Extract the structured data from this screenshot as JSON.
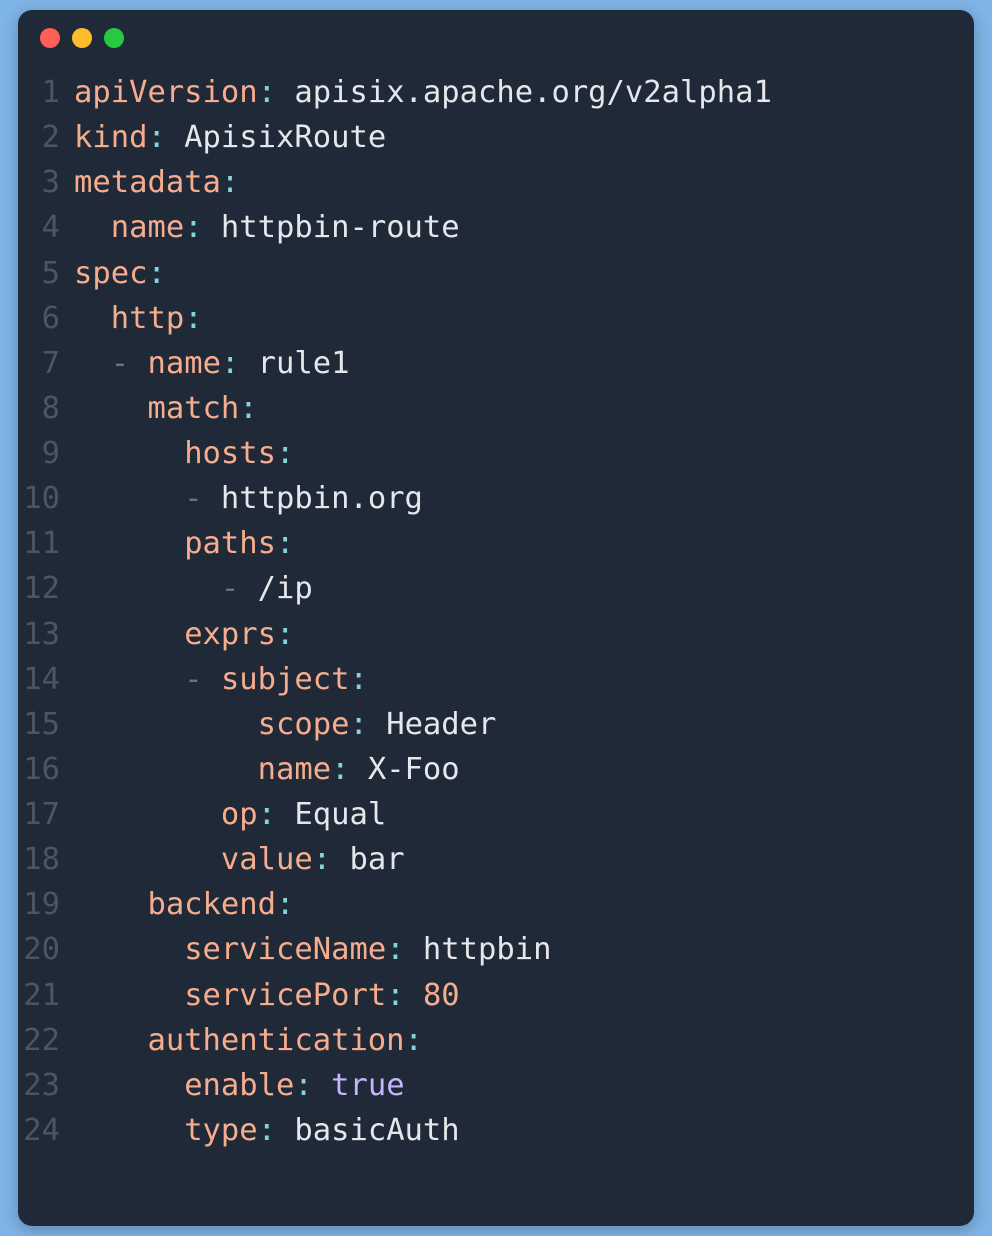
{
  "window": {
    "traffic_lights": [
      "red",
      "yellow",
      "green"
    ]
  },
  "colors": {
    "background": "#1f2937",
    "key": "#f6ad8e",
    "punct": "#83d6d8",
    "string": "#e5e7eb",
    "dash": "#6b7280",
    "bool": "#c4b5fd",
    "linenum": "#4b5563"
  },
  "code": {
    "lines": [
      {
        "n": "1",
        "tokens": [
          {
            "c": "k",
            "t": "apiVersion"
          },
          {
            "c": "p",
            "t": ":"
          },
          {
            "c": "s",
            "t": " apisix.apache.org/v2alpha1"
          }
        ]
      },
      {
        "n": "2",
        "tokens": [
          {
            "c": "k",
            "t": "kind"
          },
          {
            "c": "p",
            "t": ":"
          },
          {
            "c": "s",
            "t": " ApisixRoute"
          }
        ]
      },
      {
        "n": "3",
        "tokens": [
          {
            "c": "k",
            "t": "metadata"
          },
          {
            "c": "p",
            "t": ":"
          }
        ]
      },
      {
        "n": "4",
        "tokens": [
          {
            "c": "s",
            "t": "  "
          },
          {
            "c": "k",
            "t": "name"
          },
          {
            "c": "p",
            "t": ":"
          },
          {
            "c": "s",
            "t": " httpbin-route"
          }
        ]
      },
      {
        "n": "5",
        "tokens": [
          {
            "c": "k",
            "t": "spec"
          },
          {
            "c": "p",
            "t": ":"
          }
        ]
      },
      {
        "n": "6",
        "tokens": [
          {
            "c": "s",
            "t": "  "
          },
          {
            "c": "k",
            "t": "http"
          },
          {
            "c": "p",
            "t": ":"
          }
        ]
      },
      {
        "n": "7",
        "tokens": [
          {
            "c": "s",
            "t": "  "
          },
          {
            "c": "d",
            "t": "-"
          },
          {
            "c": "s",
            "t": " "
          },
          {
            "c": "k",
            "t": "name"
          },
          {
            "c": "p",
            "t": ":"
          },
          {
            "c": "s",
            "t": " rule1"
          }
        ]
      },
      {
        "n": "8",
        "tokens": [
          {
            "c": "s",
            "t": "    "
          },
          {
            "c": "k",
            "t": "match"
          },
          {
            "c": "p",
            "t": ":"
          }
        ]
      },
      {
        "n": "9",
        "tokens": [
          {
            "c": "s",
            "t": "      "
          },
          {
            "c": "k",
            "t": "hosts"
          },
          {
            "c": "p",
            "t": ":"
          }
        ]
      },
      {
        "n": "10",
        "tokens": [
          {
            "c": "s",
            "t": "      "
          },
          {
            "c": "d",
            "t": "-"
          },
          {
            "c": "s",
            "t": " httpbin.org"
          }
        ]
      },
      {
        "n": "11",
        "tokens": [
          {
            "c": "s",
            "t": "      "
          },
          {
            "c": "k",
            "t": "paths"
          },
          {
            "c": "p",
            "t": ":"
          }
        ]
      },
      {
        "n": "12",
        "tokens": [
          {
            "c": "s",
            "t": "        "
          },
          {
            "c": "d",
            "t": "-"
          },
          {
            "c": "s",
            "t": " /ip"
          }
        ]
      },
      {
        "n": "13",
        "tokens": [
          {
            "c": "s",
            "t": "      "
          },
          {
            "c": "k",
            "t": "exprs"
          },
          {
            "c": "p",
            "t": ":"
          }
        ]
      },
      {
        "n": "14",
        "tokens": [
          {
            "c": "s",
            "t": "      "
          },
          {
            "c": "d",
            "t": "-"
          },
          {
            "c": "s",
            "t": " "
          },
          {
            "c": "k",
            "t": "subject"
          },
          {
            "c": "p",
            "t": ":"
          }
        ]
      },
      {
        "n": "15",
        "tokens": [
          {
            "c": "s",
            "t": "          "
          },
          {
            "c": "k",
            "t": "scope"
          },
          {
            "c": "p",
            "t": ":"
          },
          {
            "c": "s",
            "t": " Header"
          }
        ]
      },
      {
        "n": "16",
        "tokens": [
          {
            "c": "s",
            "t": "          "
          },
          {
            "c": "k",
            "t": "name"
          },
          {
            "c": "p",
            "t": ":"
          },
          {
            "c": "s",
            "t": " X-Foo"
          }
        ]
      },
      {
        "n": "17",
        "tokens": [
          {
            "c": "s",
            "t": "        "
          },
          {
            "c": "k",
            "t": "op"
          },
          {
            "c": "p",
            "t": ":"
          },
          {
            "c": "s",
            "t": " Equal"
          }
        ]
      },
      {
        "n": "18",
        "tokens": [
          {
            "c": "s",
            "t": "        "
          },
          {
            "c": "k",
            "t": "value"
          },
          {
            "c": "p",
            "t": ":"
          },
          {
            "c": "s",
            "t": " bar"
          }
        ]
      },
      {
        "n": "19",
        "tokens": [
          {
            "c": "s",
            "t": "    "
          },
          {
            "c": "k",
            "t": "backend"
          },
          {
            "c": "p",
            "t": ":"
          }
        ]
      },
      {
        "n": "20",
        "tokens": [
          {
            "c": "s",
            "t": "      "
          },
          {
            "c": "k",
            "t": "serviceName"
          },
          {
            "c": "p",
            "t": ":"
          },
          {
            "c": "s",
            "t": " httpbin"
          }
        ]
      },
      {
        "n": "21",
        "tokens": [
          {
            "c": "s",
            "t": "      "
          },
          {
            "c": "k",
            "t": "servicePort"
          },
          {
            "c": "p",
            "t": ":"
          },
          {
            "c": "s",
            "t": " "
          },
          {
            "c": "n",
            "t": "80"
          }
        ]
      },
      {
        "n": "22",
        "tokens": [
          {
            "c": "s",
            "t": "    "
          },
          {
            "c": "k",
            "t": "authentication"
          },
          {
            "c": "p",
            "t": ":"
          }
        ]
      },
      {
        "n": "23",
        "tokens": [
          {
            "c": "s",
            "t": "      "
          },
          {
            "c": "k",
            "t": "enable"
          },
          {
            "c": "p",
            "t": ":"
          },
          {
            "c": "s",
            "t": " "
          },
          {
            "c": "b",
            "t": "true"
          }
        ]
      },
      {
        "n": "24",
        "tokens": [
          {
            "c": "s",
            "t": "      "
          },
          {
            "c": "k",
            "t": "type"
          },
          {
            "c": "p",
            "t": ":"
          },
          {
            "c": "s",
            "t": " basicAuth"
          }
        ]
      }
    ]
  },
  "yaml_document": {
    "apiVersion": "apisix.apache.org/v2alpha1",
    "kind": "ApisixRoute",
    "metadata": {
      "name": "httpbin-route"
    },
    "spec": {
      "http": [
        {
          "name": "rule1",
          "match": {
            "hosts": [
              "httpbin.org"
            ],
            "paths": [
              "/ip"
            ],
            "exprs": [
              {
                "subject": {
                  "scope": "Header",
                  "name": "X-Foo"
                },
                "op": "Equal",
                "value": "bar"
              }
            ]
          },
          "backend": {
            "serviceName": "httpbin",
            "servicePort": 80
          },
          "authentication": {
            "enable": true,
            "type": "basicAuth"
          }
        }
      ]
    }
  }
}
